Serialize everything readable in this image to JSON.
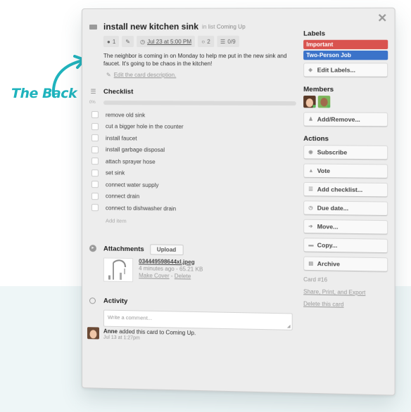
{
  "callout": {
    "text": "The Back",
    "color": "#1fb3bd"
  },
  "card": {
    "title": "install new kitchen sink",
    "list_prefix": "in list",
    "list_name": "Coming Up",
    "badges": {
      "comments": "1",
      "due": "Jul 23 at 5:00 PM",
      "votes": "2",
      "checklist": "0/9"
    },
    "description": "The neighbor is coming in on Monday to help me put in the new sink and faucet. It's going to be chaos in the kitchen!",
    "edit_description": "Edit the card description.",
    "checklist": {
      "title": "Checklist",
      "percent_label": "0%",
      "progress": 0,
      "items": [
        {
          "label": "remove old sink",
          "checked": false
        },
        {
          "label": "cut a bigger hole in the counter",
          "checked": false
        },
        {
          "label": "install faucet",
          "checked": false
        },
        {
          "label": "install garbage disposal",
          "checked": false
        },
        {
          "label": "attach sprayer hose",
          "checked": false
        },
        {
          "label": "set sink",
          "checked": false
        },
        {
          "label": "connect water supply",
          "checked": false
        },
        {
          "label": "connect drain",
          "checked": false
        },
        {
          "label": "connect to dishwasher drain",
          "checked": false
        }
      ],
      "add_item": "Add item"
    },
    "attachments": {
      "title": "Attachments",
      "upload_label": "Upload",
      "file_name": "034449598644xl.jpeg",
      "meta": "4 minutes ago - 65.21 KB",
      "make_cover": "Make Cover",
      "separator": "-",
      "delete": "Delete"
    },
    "activity": {
      "title": "Activity",
      "comment_placeholder": "Write a comment...",
      "items": [
        {
          "user": "Anne",
          "text": "added this card to Coming Up.",
          "time": "Jul 13 at 1:27pm"
        }
      ]
    }
  },
  "sidebar": {
    "labels_title": "Labels",
    "labels": [
      {
        "name": "Important",
        "color": "#d9534f"
      },
      {
        "name": "Two-Person Job",
        "color": "#3b73c9"
      }
    ],
    "edit_labels": "Edit Labels...",
    "members_title": "Members",
    "members": [
      "Anne",
      "Member 2"
    ],
    "add_remove": "Add/Remove...",
    "actions_title": "Actions",
    "actions": [
      {
        "label": "Subscribe",
        "icon": "eye-icon"
      },
      {
        "label": "Vote",
        "icon": "thumbs-up-icon"
      },
      {
        "label": "Add checklist...",
        "icon": "checklist-icon"
      },
      {
        "label": "Due date...",
        "icon": "clock-icon"
      },
      {
        "label": "Move...",
        "icon": "arrow-right-icon"
      },
      {
        "label": "Copy...",
        "icon": "copy-icon"
      },
      {
        "label": "Archive",
        "icon": "archive-icon"
      }
    ],
    "card_number": "Card #16",
    "share": "Share, Print, and Export",
    "delete_card": "Delete this card"
  }
}
